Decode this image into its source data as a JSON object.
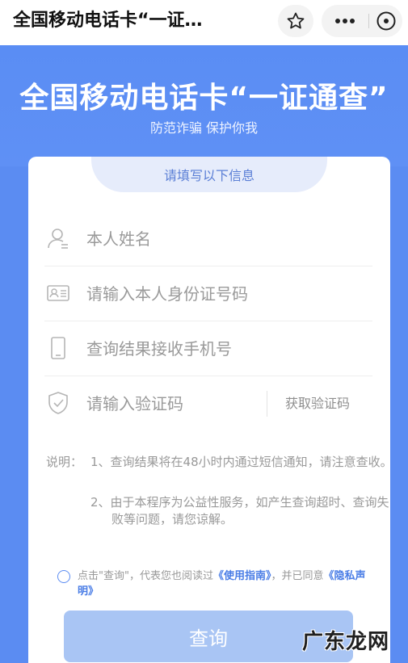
{
  "nav": {
    "title": "全国移动电话卡“一证…",
    "favorite_icon": "star-icon",
    "more_icon": "ellipsis-icon",
    "close_icon": "close-circle-icon"
  },
  "banner": {
    "title": "全国移动电话卡“一证通查”",
    "subtitle": "防范诈骗 保护你我"
  },
  "form": {
    "section_title": "请填写以下信息",
    "fields": [
      {
        "icon": "person-icon",
        "placeholder": "本人姓名"
      },
      {
        "icon": "id-card-icon",
        "placeholder": "请输入本人身份证号码"
      },
      {
        "icon": "phone-icon",
        "placeholder": "查询结果接收手机号"
      },
      {
        "icon": "shield-check-icon",
        "placeholder": "请输入验证码"
      }
    ],
    "get_code_label": "获取验证码"
  },
  "notes": {
    "label": "说明：",
    "items": [
      "1、查询结果将在48小时内通过短信通知，请注意查收。",
      "2、由于本程序为公益性服务，如产生查询超时、查询失败等问题，请您谅解。"
    ]
  },
  "agreement": {
    "prefix": "点击\"查询\"，代表您也阅读过",
    "guide_link": "《使用指南》",
    "middle": "，并已同意",
    "privacy_link": "《隐私声明》"
  },
  "submit_label": "查询",
  "watermark": "广东龙网",
  "colors": {
    "accent": "#5b8cf2",
    "button_disabled": "#a9c5f4",
    "link": "#4a7de6"
  }
}
